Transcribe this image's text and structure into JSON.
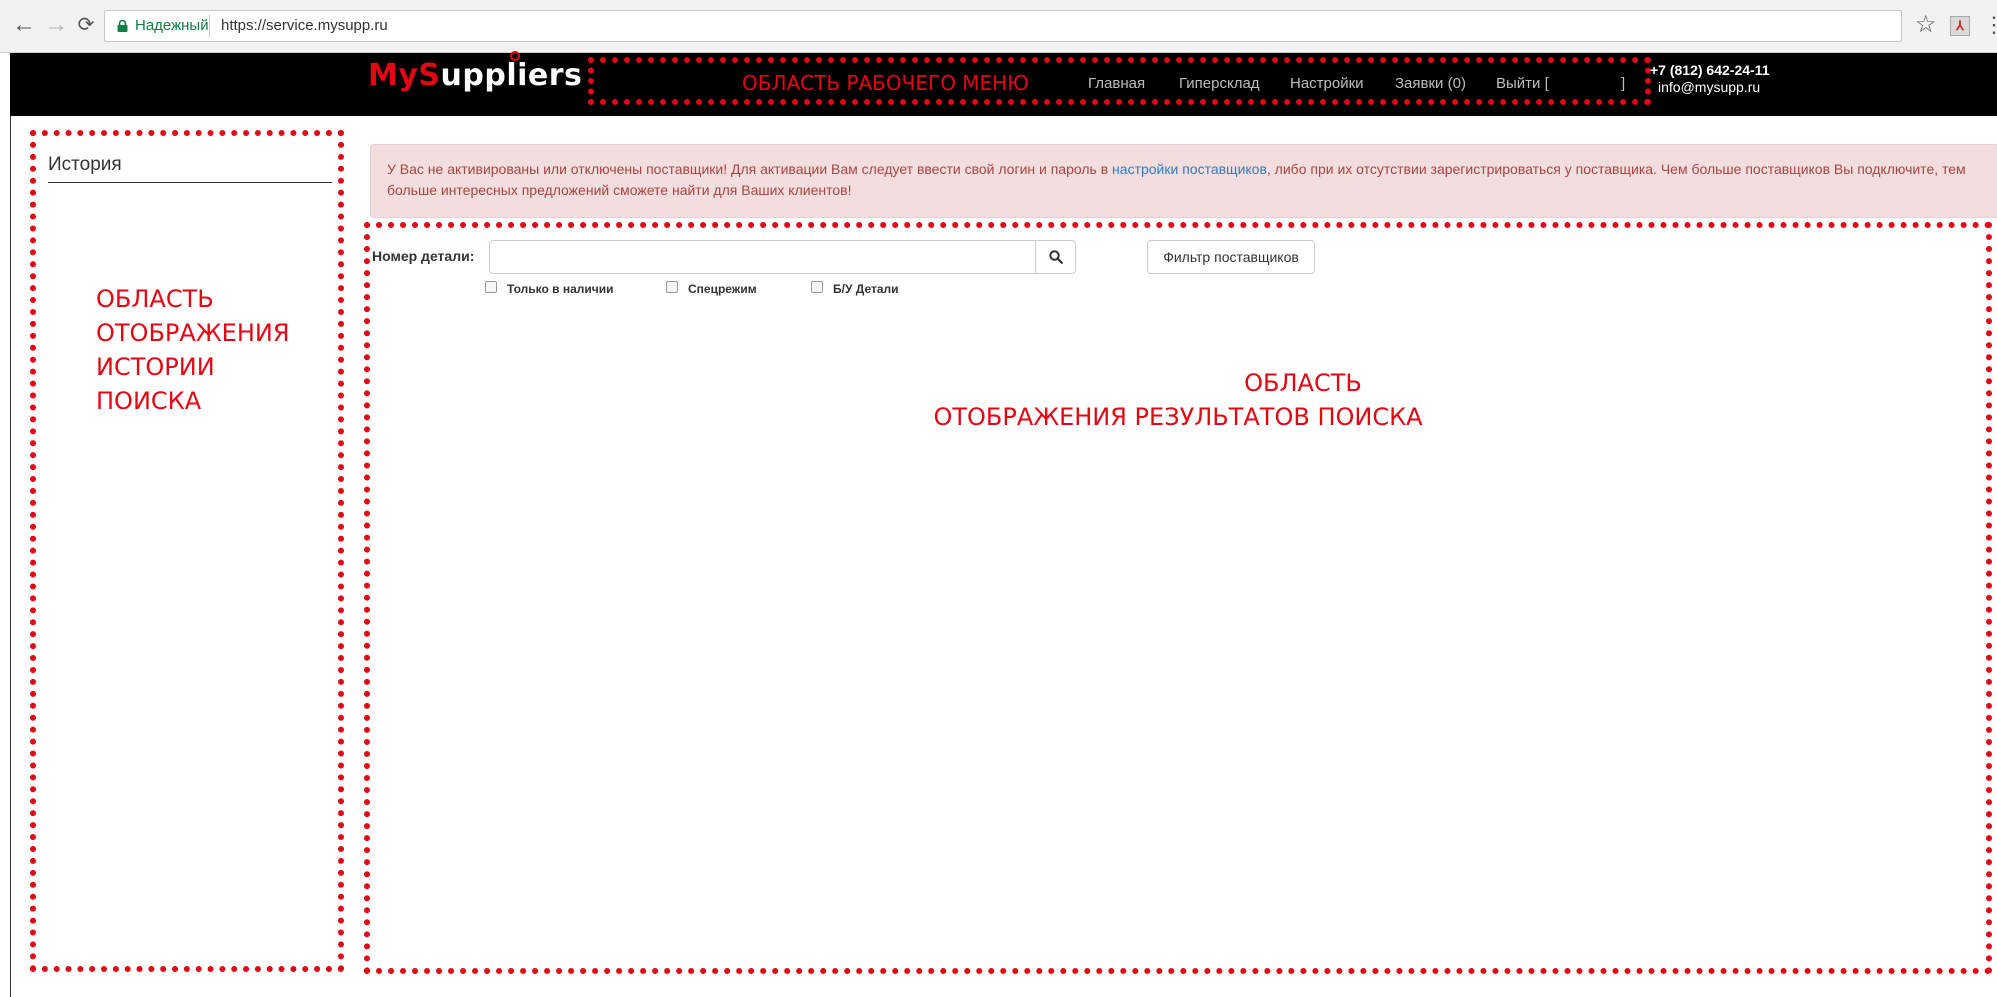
{
  "browser": {
    "secure_label": "Надежный",
    "url": "https://service.mysupp.ru",
    "icons": [
      "back-icon",
      "forward-icon",
      "reload-icon",
      "lock-icon",
      "star-icon",
      "pdf-extension-icon",
      "menu-icon"
    ]
  },
  "header": {
    "logo_my": "My",
    "logo_s": "S",
    "logo_rest": "uppliers",
    "menu_annotation": "ОБЛАСТЬ  РАБОЧЕГО МЕНЮ",
    "menu": [
      {
        "label": "Главная"
      },
      {
        "label": "Гиперсклад"
      },
      {
        "label": "Настройки"
      },
      {
        "label": "Заявки (0)"
      },
      {
        "label": "Выйти ["
      },
      {
        "label": "]"
      }
    ],
    "phone": "+7 (812) 642-24-11",
    "email": "info@mysupp.ru"
  },
  "history": {
    "title": "История",
    "annotation_lines": [
      "ОБЛАСТЬ",
      "ОТОБРАЖЕНИЯ",
      "ИСТОРИИ",
      "ПОИСКА"
    ]
  },
  "alert": {
    "text_before": "У Вас не активированы или отключены поставщики! Для активации Вам следует ввести свой логин и пароль в ",
    "link": "настройки поставщиков",
    "text_after": ", либо при их отсутствии зарегистрироваться у поставщика. Чем больше поставщиков Вы подключите, тем больше интересных предложений сможете найти для Ваших клиентов!"
  },
  "search": {
    "part_label": "Номер детали:",
    "input_value": "",
    "filter_button": "Фильтр поставщиков",
    "checkboxes": [
      {
        "label": "Только в наличии",
        "checked": false
      },
      {
        "label": "Спецрежим",
        "checked": false
      },
      {
        "label": "Б/У Детали",
        "checked": false
      }
    ]
  },
  "results": {
    "annotation_line1": "ОБЛАСТЬ",
    "annotation_line2": "ОТОБРАЖЕНИЯ РЕЗУЛЬТАТОВ ПОИСКА"
  },
  "colors": {
    "annotation_red": "#e30613",
    "header_bg": "#000000",
    "alert_bg": "#f2dede",
    "alert_text": "#a94442",
    "link": "#337ab7"
  }
}
